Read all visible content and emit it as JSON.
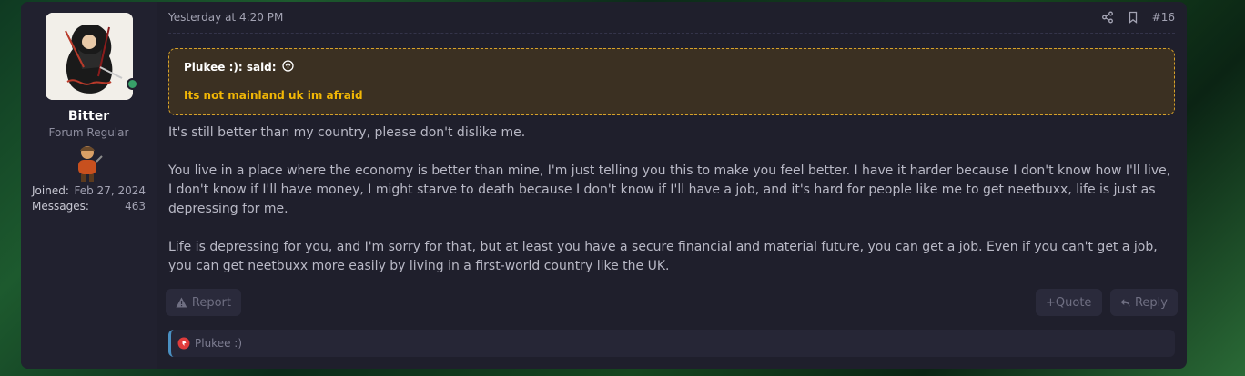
{
  "user": {
    "username": "Bitter",
    "title": "Forum Regular",
    "joined_label": "Joined:",
    "joined_value": "Feb 27, 2024",
    "messages_label": "Messages:",
    "messages_value": "463"
  },
  "post": {
    "timestamp": "Yesterday at 4:20 PM",
    "number": "#16",
    "quote": {
      "author": "Plukee :): said:",
      "text": "Its not mainland uk im afraid"
    },
    "paragraphs": [
      "It's still better than my country, please don't dislike me.",
      "You live in a place where the economy is better than mine, I'm just telling you this to make you feel better. I have it harder because I don't know how I'll live, I don't know if I'll have money, I might starve to death because I don't know if I'll have a job, and it's hard for people like me to get neetbuxx, life is just as depressing for me.",
      "Life is depressing for you, and I'm sorry for that, but at least you have a secure financial and material future, you can get a job. Even if you can't get a job, you can get neetbuxx more easily by living in a first-world country like the UK."
    ],
    "actions": {
      "report": "Report",
      "quote": "+Quote",
      "reply": "Reply"
    },
    "reactions": {
      "users": "Plukee :)"
    }
  },
  "colors": {
    "quote_border": "#d6a12a",
    "quote_text": "#f2b705",
    "online": "#38a169",
    "reaction_accent": "#4a90c2"
  },
  "icons": {
    "share": "share-icon",
    "bookmark": "bookmark-icon",
    "expand": "arrow-up-circle-icon",
    "report": "warning-icon",
    "reply": "reply-icon",
    "reaction": "thumbs-down-reaction-icon"
  }
}
